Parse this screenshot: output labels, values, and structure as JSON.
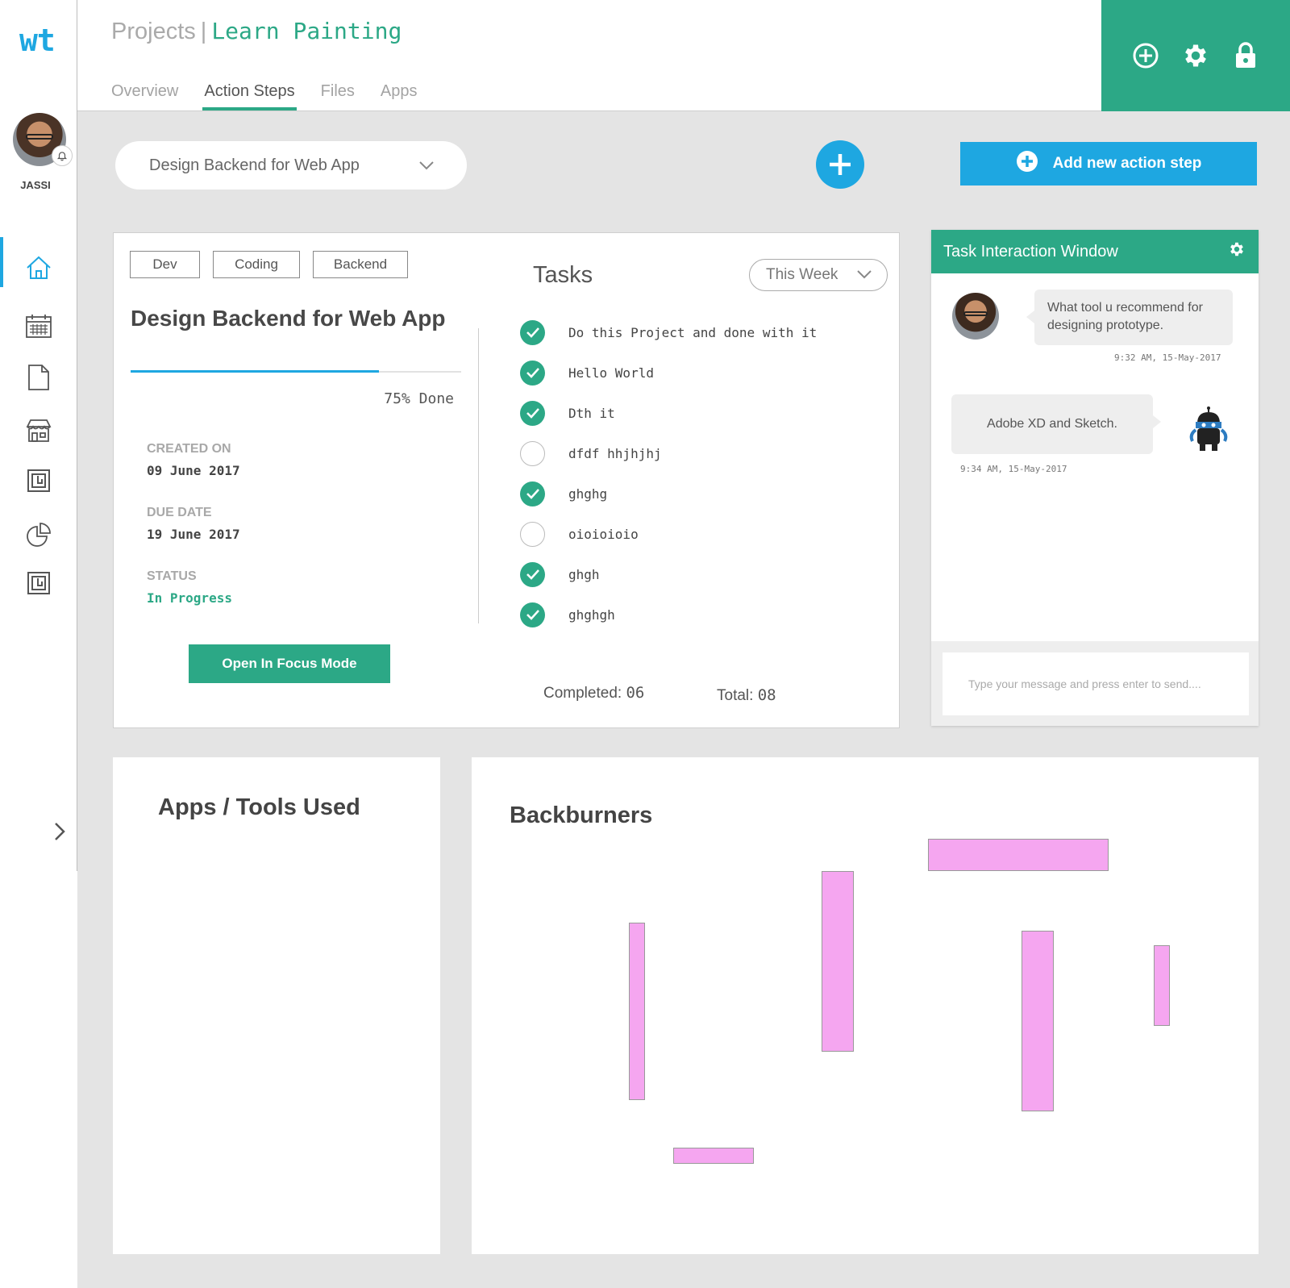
{
  "app": {
    "logo": "wt"
  },
  "user": {
    "name": "JASSI"
  },
  "sidebar": {
    "items": [
      {
        "name": "home",
        "icon": "home-icon",
        "active": true
      },
      {
        "name": "calendar",
        "icon": "calendar-icon"
      },
      {
        "name": "document",
        "icon": "document-icon"
      },
      {
        "name": "store",
        "icon": "store-icon"
      },
      {
        "name": "frame-a",
        "icon": "frame-icon"
      },
      {
        "name": "analytics",
        "icon": "pie-chart-icon"
      },
      {
        "name": "frame-b",
        "icon": "frame-icon"
      }
    ],
    "expand_icon": "chevron-right-icon"
  },
  "header": {
    "crumb": "Projects",
    "separator": "|",
    "project": "Learn Painting",
    "tabs": [
      {
        "label": "Overview",
        "active": false
      },
      {
        "label": "Action Steps",
        "active": true
      },
      {
        "label": "Files",
        "active": false
      },
      {
        "label": "Apps",
        "active": false
      }
    ],
    "actions": [
      "add-circle-icon",
      "gear-icon",
      "lock-icon"
    ]
  },
  "toolbar": {
    "selected_step": "Design Backend for Web App",
    "add_label": "Add new action step"
  },
  "action_step": {
    "tags": [
      "Dev",
      "Coding",
      "Backend"
    ],
    "title": "Design Backend for Web App",
    "progress_percent": 75,
    "progress_label": "75% Done",
    "created_label": "CREATED ON",
    "created_value": "09 June 2017",
    "due_label": "DUE DATE",
    "due_value": "19 June 2017",
    "status_label": "STATUS",
    "status_value": "In Progress",
    "focus_button": "Open In Focus Mode"
  },
  "tasks": {
    "title": "Tasks",
    "filter": "This Week",
    "items": [
      {
        "label": "Do this Project and done with it",
        "done": true
      },
      {
        "label": "Hello World",
        "done": true
      },
      {
        "label": "Dth it",
        "done": true
      },
      {
        "label": "dfdf hhjhjhj",
        "done": false
      },
      {
        "label": "ghghg",
        "done": true
      },
      {
        "label": "oioioioio",
        "done": false
      },
      {
        "label": "ghgh",
        "done": true
      },
      {
        "label": "ghghgh",
        "done": true
      }
    ],
    "completed_label": "Completed:",
    "completed_value": "06",
    "total_label": "Total:",
    "total_value": "08"
  },
  "chat": {
    "title": "Task Interaction Window",
    "messages": [
      {
        "from": "user",
        "text": "What tool u recommend for designing prototype.",
        "time": "9:32 AM, 15-May-2017"
      },
      {
        "from": "bot",
        "text": "Adobe XD and Sketch.",
        "time": "9:34 AM, 15-May-2017"
      }
    ],
    "input_placeholder": "Type your message and press enter to send...."
  },
  "apps_panel": {
    "title": "Apps / Tools Used"
  },
  "backburners": {
    "title": "Backburners",
    "color": "#f5a6f0"
  },
  "colors": {
    "accent_green": "#2ca886",
    "accent_blue": "#1ea7e1"
  }
}
